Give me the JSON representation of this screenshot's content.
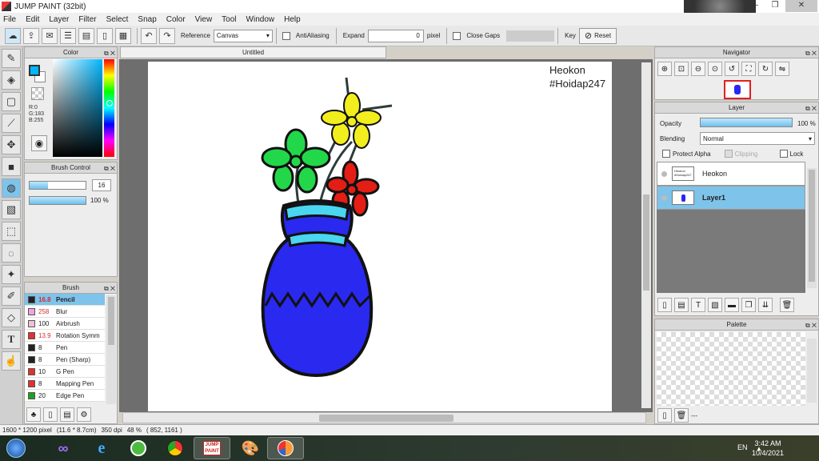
{
  "window": {
    "title": "JUMP PAINT (32bit)",
    "minimize": "—",
    "restore": "❐",
    "close": "✕"
  },
  "menu": [
    "File",
    "Edit",
    "Layer",
    "Filter",
    "Select",
    "Snap",
    "Color",
    "View",
    "Tool",
    "Window",
    "Help"
  ],
  "toolbar": {
    "reference_label": "Reference",
    "reference_value": "Canvas",
    "antialiasing_label": "AntiAliasing",
    "expand_label": "Expand",
    "expand_value": "0",
    "expand_unit": "pixel",
    "close_gaps_label": "Close Gaps",
    "key_label": "Key",
    "reset_label": "Reset"
  },
  "color_panel": {
    "title": "Color",
    "r": "R:0",
    "g": "G:183",
    "b": "B:255",
    "foreground": "#00b7ff"
  },
  "brush_control": {
    "title": "Brush Control",
    "size_value": "16",
    "size_fill": 0.33,
    "opacity_value": "100 %",
    "opacity_fill": 1.0
  },
  "brush_panel": {
    "title": "Brush",
    "items": [
      {
        "size": "16.8",
        "name": "Pencil",
        "color": "#222222",
        "red": true,
        "selected": true
      },
      {
        "size": "258",
        "name": "Blur",
        "color": "#f5a0e0",
        "red": true,
        "selected": false
      },
      {
        "size": "100",
        "name": "Airbrush",
        "color": "#f0c0d8",
        "red": false,
        "selected": false
      },
      {
        "size": "13.9",
        "name": "Rotation Symm",
        "color": "#e03030",
        "red": true,
        "selected": false
      },
      {
        "size": "8",
        "name": "Pen",
        "color": "#222222",
        "red": false,
        "selected": false
      },
      {
        "size": "8",
        "name": "Pen (Sharp)",
        "color": "#222222",
        "red": false,
        "selected": false
      },
      {
        "size": "10",
        "name": "G Pen",
        "color": "#e03030",
        "red": false,
        "selected": false
      },
      {
        "size": "8",
        "name": "Mapping Pen",
        "color": "#e03030",
        "red": false,
        "selected": false
      },
      {
        "size": "20",
        "name": "Edge Pen",
        "color": "#20a020",
        "red": false,
        "selected": false
      }
    ]
  },
  "canvas": {
    "tab": "Untitled",
    "signature_name": "Heokon",
    "signature_tag": "#Hoidap247"
  },
  "status": {
    "size": "1600 * 1200 pixel",
    "cm": "(11.6 * 8.7cm)",
    "dpi": "350 dpi",
    "zoom": "48 %",
    "cursor": "( 852, 1161 )"
  },
  "navigator": {
    "title": "Navigator"
  },
  "layer_panel": {
    "title": "Layer",
    "opacity_label": "Opacity",
    "opacity_value": "100 %",
    "blending_label": "Blending",
    "blending_value": "Normal",
    "protect_alpha": "Protect Alpha",
    "clipping": "Clipping",
    "lock": "Lock",
    "layers": [
      {
        "name": "Heokon",
        "selected": false
      },
      {
        "name": "Layer1",
        "selected": true
      }
    ]
  },
  "palette": {
    "title": "Palette",
    "more": "---"
  },
  "taskbar": {
    "lang": "EN",
    "time": "3:42 AM",
    "date": "10/4/2021"
  }
}
